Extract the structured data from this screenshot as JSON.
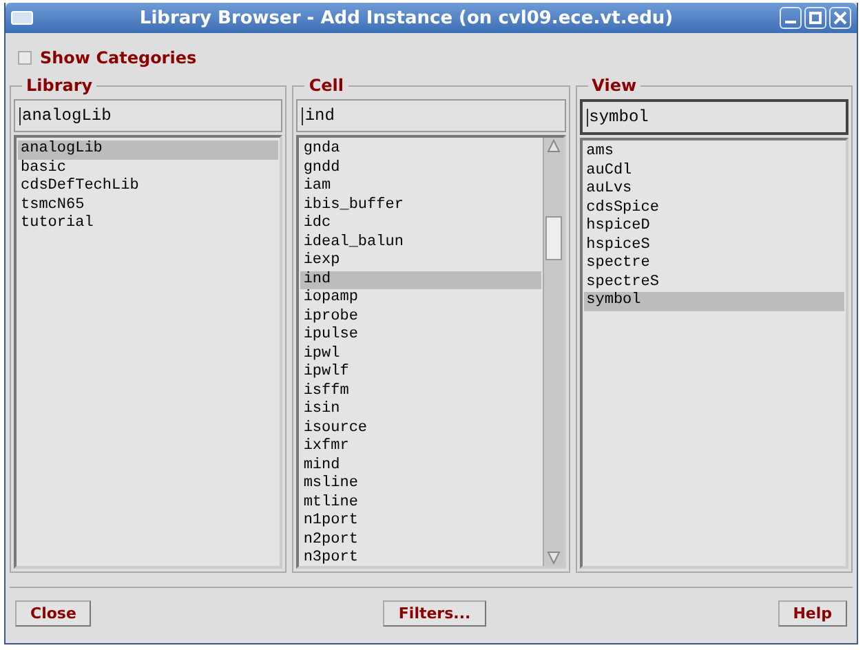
{
  "window": {
    "title": "Library Browser - Add Instance (on cvl09.ece.vt.edu)"
  },
  "show_categories": {
    "label": "Show Categories",
    "checked": false
  },
  "panes": [
    {
      "title": "Library",
      "value": "analogLib",
      "focused": false,
      "scrollbar": false,
      "items": [
        {
          "label": "analogLib",
          "selected": true
        },
        {
          "label": "basic",
          "selected": false
        },
        {
          "label": "cdsDefTechLib",
          "selected": false
        },
        {
          "label": "tsmcN65",
          "selected": false
        },
        {
          "label": "tutorial",
          "selected": false
        }
      ]
    },
    {
      "title": "Cell",
      "value": "ind",
      "focused": false,
      "scrollbar": true,
      "items": [
        {
          "label": "gnda",
          "selected": false
        },
        {
          "label": "gndd",
          "selected": false
        },
        {
          "label": "iam",
          "selected": false
        },
        {
          "label": "ibis_buffer",
          "selected": false
        },
        {
          "label": "idc",
          "selected": false
        },
        {
          "label": "ideal_balun",
          "selected": false
        },
        {
          "label": "iexp",
          "selected": false
        },
        {
          "label": "ind",
          "selected": true
        },
        {
          "label": "iopamp",
          "selected": false
        },
        {
          "label": "iprobe",
          "selected": false
        },
        {
          "label": "ipulse",
          "selected": false
        },
        {
          "label": "ipwl",
          "selected": false
        },
        {
          "label": "ipwlf",
          "selected": false
        },
        {
          "label": "isffm",
          "selected": false
        },
        {
          "label": "isin",
          "selected": false
        },
        {
          "label": "isource",
          "selected": false
        },
        {
          "label": "ixfmr",
          "selected": false
        },
        {
          "label": "mind",
          "selected": false
        },
        {
          "label": "msline",
          "selected": false
        },
        {
          "label": "mtline",
          "selected": false
        },
        {
          "label": "n1port",
          "selected": false
        },
        {
          "label": "n2port",
          "selected": false
        },
        {
          "label": "n3port",
          "selected": false
        }
      ]
    },
    {
      "title": "View",
      "value": "symbol",
      "focused": true,
      "scrollbar": false,
      "items": [
        {
          "label": "ams",
          "selected": false
        },
        {
          "label": "auCdl",
          "selected": false
        },
        {
          "label": "auLvs",
          "selected": false
        },
        {
          "label": "cdsSpice",
          "selected": false
        },
        {
          "label": "hspiceD",
          "selected": false
        },
        {
          "label": "hspiceS",
          "selected": false
        },
        {
          "label": "spectre",
          "selected": false
        },
        {
          "label": "spectreS",
          "selected": false
        },
        {
          "label": "symbol",
          "selected": true
        }
      ]
    }
  ],
  "buttons": [
    "Close",
    "Filters...",
    "Help"
  ]
}
